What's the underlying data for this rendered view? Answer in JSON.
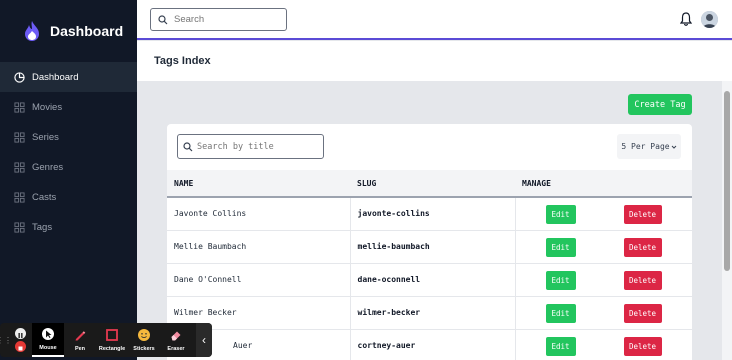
{
  "brand": {
    "title": "Dashboard"
  },
  "sidebar": {
    "items": [
      {
        "label": "Dashboard",
        "icon": "pie-chart-icon"
      },
      {
        "label": "Movies",
        "icon": "grid-icon"
      },
      {
        "label": "Series",
        "icon": "grid-icon"
      },
      {
        "label": "Genres",
        "icon": "grid-icon"
      },
      {
        "label": "Casts",
        "icon": "grid-icon"
      },
      {
        "label": "Tags",
        "icon": "grid-icon"
      }
    ]
  },
  "topbar": {
    "search_placeholder": "Search"
  },
  "page": {
    "title": "Tags Index",
    "create_label": "Create Tag"
  },
  "card": {
    "search_placeholder": "Search by title",
    "per_page": "5 Per Page"
  },
  "table": {
    "headers": {
      "name": "NAME",
      "slug": "SLUG",
      "manage": "MANAGE"
    },
    "rows": [
      {
        "name": "Javonte Collins",
        "slug": "javonte-collins"
      },
      {
        "name": "Mellie Baumbach",
        "slug": "mellie-baumbach"
      },
      {
        "name": "Dane O'Connell",
        "slug": "dane-oconnell"
      },
      {
        "name": "Wilmer Becker",
        "slug": "wilmer-becker"
      },
      {
        "name": "Auer",
        "slug": "cortney-auer"
      }
    ],
    "edit_label": "Edit",
    "delete_label": "Delete"
  },
  "toolbar": {
    "tools": [
      {
        "label": "Mouse",
        "icon": "cursor-icon"
      },
      {
        "label": "Pen",
        "icon": "pen-icon"
      },
      {
        "label": "Rectangle",
        "icon": "rectangle-icon"
      },
      {
        "label": "Stickers",
        "icon": "smiley-icon"
      },
      {
        "label": "Eraser",
        "icon": "eraser-icon"
      }
    ],
    "collapse": "‹"
  },
  "colors": {
    "accent": "#5b4bd6",
    "green": "#22c55e",
    "red": "#dc2645",
    "sidebar": "#111827"
  }
}
